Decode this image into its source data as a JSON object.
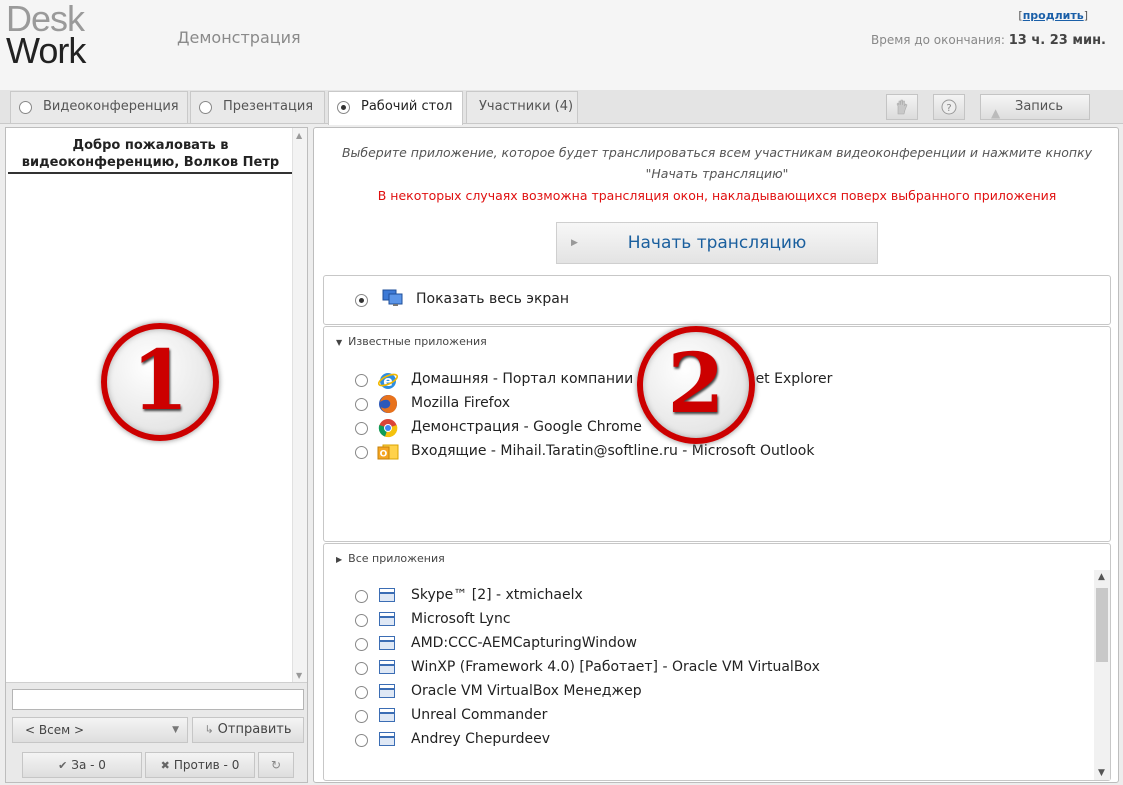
{
  "header": {
    "logo_line1": "Desk",
    "logo_line2": "Work",
    "title": "Демонстрация",
    "renew_link": "продлить",
    "time_left_label": "Время до окончания:",
    "time_left_value": "13 ч. 23 мин."
  },
  "tabs": [
    {
      "label": "Видеоконференция",
      "selected": false
    },
    {
      "label": "Презентация",
      "selected": false
    },
    {
      "label": "Рабочий стол",
      "selected": true
    },
    {
      "label": "Участники (4)"
    }
  ],
  "toolbar": {
    "raise_hand_icon": "hand-icon",
    "help_icon": "question-icon",
    "record_label": "Запись"
  },
  "left_panel": {
    "welcome_text": "Добро пожаловать в видеоконференцию, Волков Петр",
    "badge_number": "1",
    "recipient_select": "< Всем >",
    "send_label": "Отправить",
    "vote_for": "За - 0",
    "vote_against": "Против - 0"
  },
  "right_panel": {
    "instructions": "Выберите приложение, которое будет транслироваться всем участникам видеоконференции и нажмите кнопку \"Начать трансляцию\"",
    "warning": "В некоторых случаях возможна трансляция окон, накладывающихся поверх выбранного приложения",
    "warning_color": "#e01010",
    "start_button": "Начать трансляцию",
    "full_screen_label": "Показать весь экран",
    "badge_number": "2",
    "known_apps_title": "Известные приложения",
    "known_apps": [
      {
        "label": "Домашняя - Портал компании - Windows Internet Explorer",
        "icon": "ie-icon"
      },
      {
        "label": "Mozilla Firefox",
        "icon": "firefox-icon"
      },
      {
        "label": "Демонстрация - Google Chrome",
        "icon": "chrome-icon"
      },
      {
        "label": "Входящие - Mihail.Taratin@softline.ru - Microsoft Outlook",
        "icon": "outlook-icon"
      }
    ],
    "all_apps_title": "Все приложения",
    "all_apps": [
      "Skype™ [2] - xtmichaelx",
      "Microsoft Lync",
      "AMD:CCC-AEMCapturingWindow",
      "WinXP (Framework 4.0) [Работает] - Oracle VM VirtualBox",
      "Oracle VM VirtualBox Менеджер",
      "Unreal Commander",
      "Andrey Chepurdeev"
    ]
  }
}
